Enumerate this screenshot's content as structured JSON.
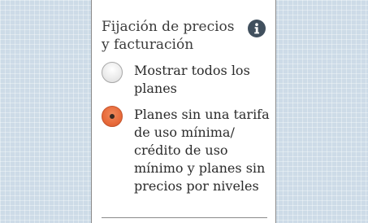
{
  "pricing_filter": {
    "title": "Fijación de precios y facturación",
    "info_icon": "info-icon",
    "options": [
      {
        "label": "Mostrar todos los planes",
        "selected": false
      },
      {
        "label": "Planes sin una tarifa de uso mínima/ crédito de uso mínimo y planes sin precios por niveles",
        "selected": true
      }
    ]
  },
  "colors": {
    "background": "#cddbe7",
    "panel": "#ffffff",
    "selected_radio": "#e86a3a",
    "info_icon": "#41505e"
  }
}
